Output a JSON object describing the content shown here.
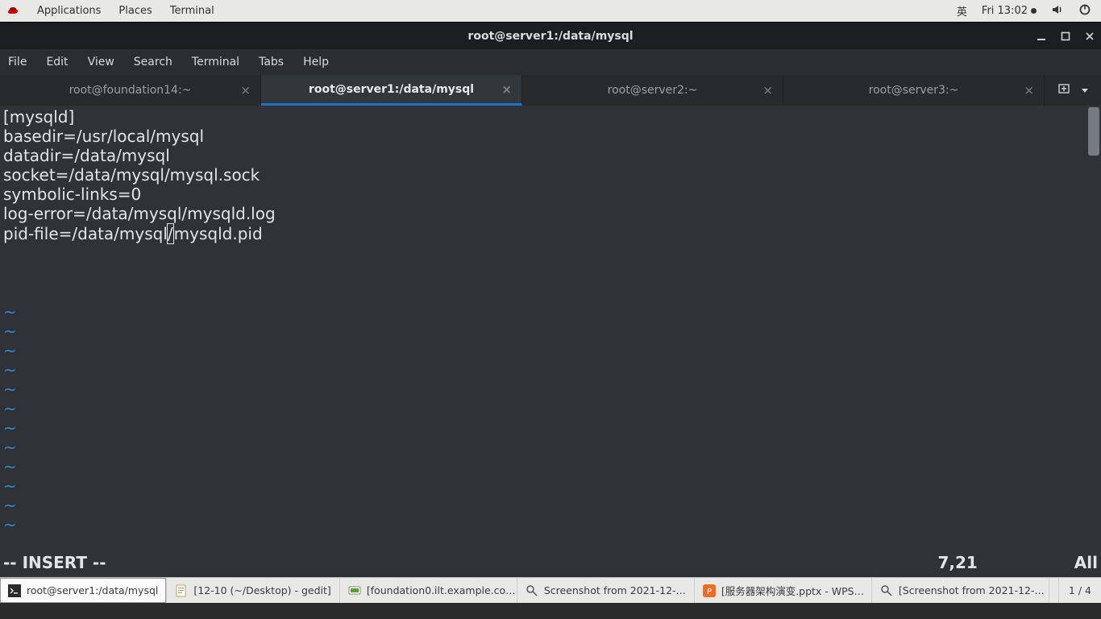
{
  "top_panel": {
    "menus": [
      "Applications",
      "Places",
      "Terminal"
    ],
    "ime": "英",
    "clock": "Fri 13:02"
  },
  "window": {
    "title": "root@server1:/data/mysql",
    "menubar": [
      "File",
      "Edit",
      "View",
      "Search",
      "Terminal",
      "Tabs",
      "Help"
    ],
    "tabs": [
      {
        "label": "root@foundation14:~",
        "active": false
      },
      {
        "label": "root@server1:/data/mysql",
        "active": true
      },
      {
        "label": "root@server2:~",
        "active": false
      },
      {
        "label": "root@server3:~",
        "active": false
      }
    ]
  },
  "editor": {
    "lines": [
      "[mysqld]",
      "basedir=/usr/local/mysql",
      "datadir=/data/mysql",
      "socket=/data/mysql/mysql.sock",
      "symbolic-links=0",
      "log-error=/data/mysql/mysqld.log"
    ],
    "cursor_line_pre": "pid-file=/data/mysql",
    "cursor_char": "/",
    "cursor_line_post": "mysqld.pid",
    "mode": "-- INSERT --",
    "position": "7,21",
    "percent": "All"
  },
  "taskbar": {
    "items": [
      {
        "label": "root@server1:/data/mysql",
        "icon": "terminal",
        "active": true
      },
      {
        "label": "[12-10 (~/Desktop) - gedit]",
        "icon": "gedit",
        "active": false
      },
      {
        "label": "[foundation0.ilt.example.co…",
        "icon": "vm",
        "active": false
      },
      {
        "label": "Screenshot from 2021-12-…",
        "icon": "image",
        "active": false
      },
      {
        "label": "[服务器架构演变.pptx - WPS…",
        "icon": "wps",
        "active": false
      },
      {
        "label": "[Screenshot from 2021-12-…",
        "icon": "image",
        "active": false
      }
    ],
    "workspace": "1 / 4"
  }
}
